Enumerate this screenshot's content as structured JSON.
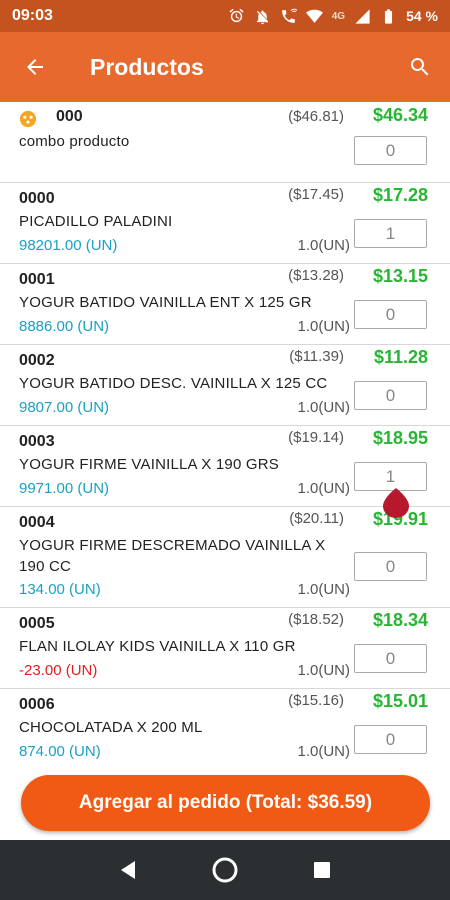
{
  "status": {
    "time": "09:03",
    "signal_label": "4G",
    "battery": "54 %"
  },
  "appbar": {
    "title": "Productos"
  },
  "items": [
    {
      "code": "000",
      "name": "combo producto",
      "stock": "",
      "unit": "",
      "old_price": "($46.81)",
      "price": "$46.34",
      "qty": "0",
      "combo": true
    },
    {
      "code": "0000",
      "name": "PICADILLO PALADINI",
      "stock": "98201.00 (UN)",
      "unit": "1.0(UN)",
      "old_price": "($17.45)",
      "price": "$17.28",
      "qty": "1"
    },
    {
      "code": "0001",
      "name": "YOGUR BATIDO VAINILLA ENT X 125 GR",
      "stock": "8886.00 (UN)",
      "unit": "1.0(UN)",
      "old_price": "($13.28)",
      "price": "$13.15",
      "qty": "0"
    },
    {
      "code": "0002",
      "name": "YOGUR BATIDO DESC. VAINILLA X 125 CC",
      "stock": "9807.00 (UN)",
      "unit": "1.0(UN)",
      "old_price": "($11.39)",
      "price": "$11.28",
      "qty": "0"
    },
    {
      "code": "0003",
      "name": "YOGUR FIRME VAINILLA X 190 GRS",
      "stock": "9971.00 (UN)",
      "unit": "1.0(UN)",
      "old_price": "($19.14)",
      "price": "$18.95",
      "qty": "1"
    },
    {
      "code": "0004",
      "name": "YOGUR FIRME DESCREMADO VAINILLA X 190 CC",
      "stock": "134.00 (UN)",
      "unit": "1.0(UN)",
      "old_price": "($20.11)",
      "price": "$19.91",
      "qty": "0"
    },
    {
      "code": "0005",
      "name": "FLAN ILOLAY KIDS VAINILLA X 110 GR",
      "stock": "-23.00 (UN)",
      "unit": "1.0(UN)",
      "old_price": "($18.52)",
      "price": "$18.34",
      "qty": "0"
    },
    {
      "code": "0006",
      "name": "CHOCOLATADA X 200 ML",
      "stock": "874.00 (UN)",
      "unit": "1.0(UN)",
      "old_price": "($15.16)",
      "price": "$15.01",
      "qty": "0"
    }
  ],
  "footer": {
    "add_button": "Agregar al pedido (Total: $36.59)"
  },
  "colors": {
    "appbar": "#e8692e",
    "status_bar": "#c4531f",
    "price_green": "#27b633",
    "stock_blue": "#1aa0c4",
    "stock_negative": "#e02020",
    "button": "#f05a14"
  }
}
